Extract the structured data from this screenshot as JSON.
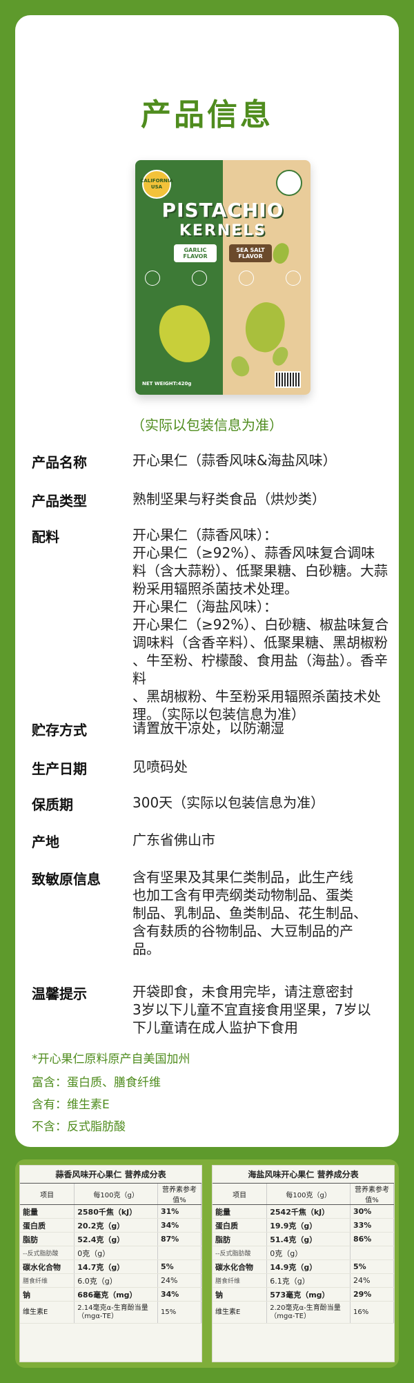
{
  "page_title": "产品信息",
  "package": {
    "badge_left": "CALIFORNIA USA",
    "brand": "PISTACHIO",
    "sub": "KERNELS",
    "flavor_left": "GARLIC FLAVOR",
    "flavor_right": "SEA SALT FLAVOR",
    "weight": "NET WEIGHT:420g"
  },
  "caption": "（实际以包装信息为准）",
  "info": {
    "name": {
      "label": "产品名称",
      "value": "开心果仁（蒜香风味&海盐风味）"
    },
    "type": {
      "label": "产品类型",
      "value": "熟制坚果与籽类食品（烘炒类）"
    },
    "ingredients": {
      "label": "配料",
      "lines": [
        "开心果仁（蒜香风味）：",
        "开心果仁（≥92%）、蒜香风味复合调味",
        "料（含大蒜粉）、低聚果糖、白砂糖。大蒜",
        "粉采用辐照杀菌技术处理。",
        "开心果仁（海盐风味）：",
        "开心果仁（≥92%）、白砂糖、椒盐味复合",
        "调味料（含香辛料）、低聚果糖、黑胡椒粉",
        "、牛至粉、柠檬酸、食用盐（海盐）。香辛料",
        "、黑胡椒粉、牛至粉采用辐照杀菌技术处",
        "理。（实际以包装信息为准）"
      ]
    },
    "storage": {
      "label": "贮存方式",
      "value": "请置放干凉处，以防潮湿"
    },
    "date": {
      "label": "生产日期",
      "value": "见喷码处"
    },
    "shelf": {
      "label": "保质期",
      "value": "300天（实际以包装信息为准）"
    },
    "origin": {
      "label": "产地",
      "value": "广东省佛山市"
    },
    "allergen": {
      "label": "致敏原信息",
      "lines": [
        "含有坚果及其果仁类制品，此生产线",
        "也加工含有甲壳纲类动物制品、蛋类",
        "制品、乳制品、鱼类制品、花生制品、",
        "含有麸质的谷物制品、大豆制品的产",
        "品。"
      ]
    },
    "tips": {
      "label": "温馨提示",
      "lines": [
        "开袋即食，未食用完毕，请注意密封",
        "3岁以下儿童不宜直接食用坚果，7岁以",
        "下儿童请在成人监护下食用"
      ]
    }
  },
  "extras": {
    "origin_note": "*开心果仁原料原产自美国加州",
    "rich": "富含：蛋白质、膳食纤维",
    "contains": "含有：维生素E",
    "free": "不含：反式脂肪酸"
  },
  "nutrition": {
    "headers": [
      "项目",
      "每100克（g）",
      "营养素参考值%"
    ],
    "left": {
      "title": "蒜香风味开心果仁 营养成分表",
      "rows": [
        [
          "能量",
          "2580千焦（kJ）",
          "31%"
        ],
        [
          "蛋白质",
          "20.2克（g）",
          "34%"
        ],
        [
          "脂肪",
          "52.4克（g）",
          "87%"
        ],
        [
          "--反式脂肪酸",
          "0克（g）",
          ""
        ],
        [
          "碳水化合物",
          "14.7克（g）",
          "5%"
        ],
        [
          "膳食纤维",
          "6.0克（g）",
          "24%"
        ],
        [
          "钠",
          "686毫克（mg）",
          "34%"
        ],
        [
          "维生素E",
          "2.14毫克α-生育酚当量（mgα-TE）",
          "15%"
        ]
      ]
    },
    "right": {
      "title": "海盐风味开心果仁 营养成分表",
      "rows": [
        [
          "能量",
          "2542千焦（kJ）",
          "30%"
        ],
        [
          "蛋白质",
          "19.9克（g）",
          "33%"
        ],
        [
          "脂肪",
          "51.4克（g）",
          "86%"
        ],
        [
          "--反式脂肪酸",
          "0克（g）",
          ""
        ],
        [
          "碳水化合物",
          "14.9克（g）",
          "5%"
        ],
        [
          "膳食纤维",
          "6.1克（g）",
          "24%"
        ],
        [
          "钠",
          "573毫克（mg）",
          "29%"
        ],
        [
          "维生素E",
          "2.20毫克α-生育酚当量（mgα-TE）",
          "16%"
        ]
      ]
    }
  }
}
